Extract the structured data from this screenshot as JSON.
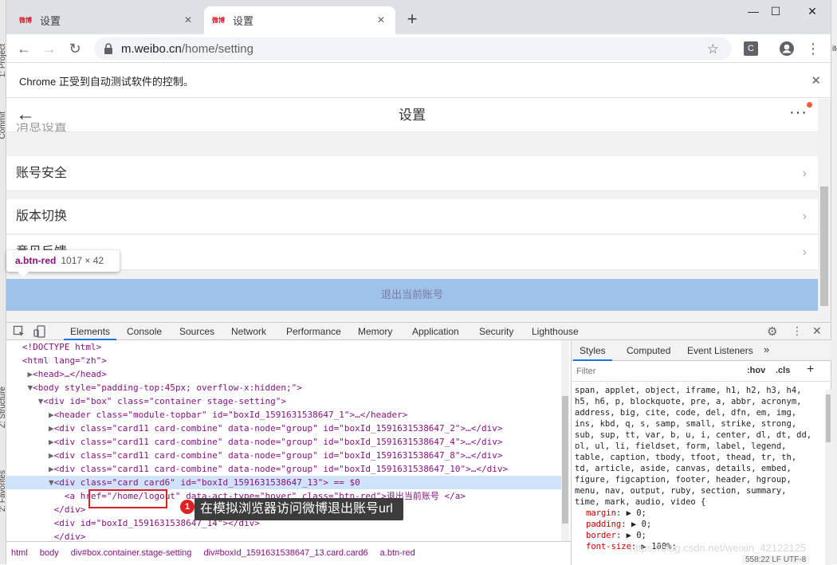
{
  "ide": {
    "left_labels": [
      "1: Project",
      "Commit",
      "Z: Structure",
      "2: Favorites"
    ],
    "right_labels": [
      "ite"
    ]
  },
  "browser": {
    "tabs": [
      {
        "favicon_text": "微博",
        "title": "设置"
      },
      {
        "favicon_text": "微博",
        "title": "设置"
      }
    ],
    "new_tab": "+",
    "window_controls": {
      "minimize": "—",
      "maximize": "☐",
      "close": "✕"
    },
    "url_host": "m.weibo.cn",
    "url_path": "/home/setting",
    "infobar_text": "Chrome 正受到自动测试软件的控制。",
    "ext_letter": "C"
  },
  "mobile": {
    "title": "设置",
    "partial_row": "消息设置",
    "rows": [
      "账号安全",
      "版本切换",
      "意见反馈"
    ],
    "logout_label": "退出当前账号",
    "chevron": "›"
  },
  "inspect_tooltip": {
    "tag": "a.btn-red",
    "dimensions": "1017 × 42"
  },
  "devtools": {
    "tabs": [
      "Elements",
      "Console",
      "Sources",
      "Network",
      "Performance",
      "Memory",
      "Application",
      "Security",
      "Lighthouse"
    ],
    "active_tab": "Elements",
    "elements": [
      {
        "indent": 0,
        "arrow": "",
        "html": "<!DOCTYPE html>"
      },
      {
        "indent": 0,
        "arrow": "",
        "html": "<html lang=\"zh\">"
      },
      {
        "indent": 1,
        "arrow": "▶",
        "html": "<head>…</head>"
      },
      {
        "indent": 1,
        "arrow": "▼",
        "html": "<body style=\"padding-top:45px; overflow-x:hidden;\">"
      },
      {
        "indent": 2,
        "arrow": "▼",
        "html": "<div id=\"box\" class=\"container stage-setting\">"
      },
      {
        "indent": 3,
        "arrow": "▶",
        "html": "<header class=\"module-topbar\" id=\"boxId_1591631538647_1\">…</header>"
      },
      {
        "indent": 3,
        "arrow": "▶",
        "html": "<div class=\"card11 card-combine\" data-node=\"group\" id=\"boxId_1591631538647_2\">…</div>"
      },
      {
        "indent": 3,
        "arrow": "▶",
        "html": "<div class=\"card11 card-combine\" data-node=\"group\" id=\"boxId_1591631538647_4\">…</div>"
      },
      {
        "indent": 3,
        "arrow": "▶",
        "html": "<div class=\"card11 card-combine\" data-node=\"group\" id=\"boxId_1591631538647_8\">…</div>"
      },
      {
        "indent": 3,
        "arrow": "▶",
        "html": "<div class=\"card11 card-combine\" data-node=\"group\" id=\"boxId_1591631538647_10\">…</div>"
      },
      {
        "indent": 3,
        "arrow": "▼",
        "html": "<div class=\"card card6\" id=\"boxId_1591631538647_13\"> == $0"
      },
      {
        "indent": 4,
        "arrow": "",
        "html": "<a href=\"/home/logout\" data-act-type=\"hover\" class=\"btn-red\">退出当前账号 </a>"
      },
      {
        "indent": 3,
        "arrow": "",
        "html": "</div>"
      },
      {
        "indent": 3,
        "arrow": "",
        "html": "<div id=\"boxId_1591631538647_14\"></div>"
      },
      {
        "indent": 3,
        "arrow": "",
        "html": "</div>"
      }
    ],
    "breadcrumbs": [
      "html",
      "body",
      "div#box.container.stage-setting",
      "div#boxId_1591631538647_13.card.card6",
      "a.btn-red"
    ],
    "styles_tabs": [
      "Styles",
      "Computed",
      "Event Listeners",
      "»"
    ],
    "filter_placeholder": "Filter",
    "hov": ":hov",
    "cls": ".cls",
    "add": "+",
    "css_selector_text": "span, applet, object, iframe, h1, h2, h3, h4, h5, h6, p, blockquote, pre, a, abbr, acronym, address, big, cite, code, del, dfn, em, img, ins, kbd, q, s, samp, small, strike, strong, sub, sup, tt, var, b, u, i, center, dl, dt, dd, ol, ul, li, fieldset, form, label, legend, table, caption, tbody, tfoot, thead, tr, th, td, article, aside, canvas, details, embed, figure, figcaption, footer, header, hgroup, menu, nav, output, ruby, section, summary, time, mark, audio, video {",
    "css_props": [
      {
        "name": "margin",
        "value": "0;"
      },
      {
        "name": "padding",
        "value": "0;"
      },
      {
        "name": "border",
        "value": "0;"
      },
      {
        "name": "font-size",
        "value": "100%;"
      }
    ],
    "status_line": "558:22  LF  UTF-8"
  },
  "annotation": {
    "number": "1",
    "label": "在模拟浏览器访问微博退出账号url"
  },
  "watermark": "https://blog.csdn.net/weixin_42122125"
}
